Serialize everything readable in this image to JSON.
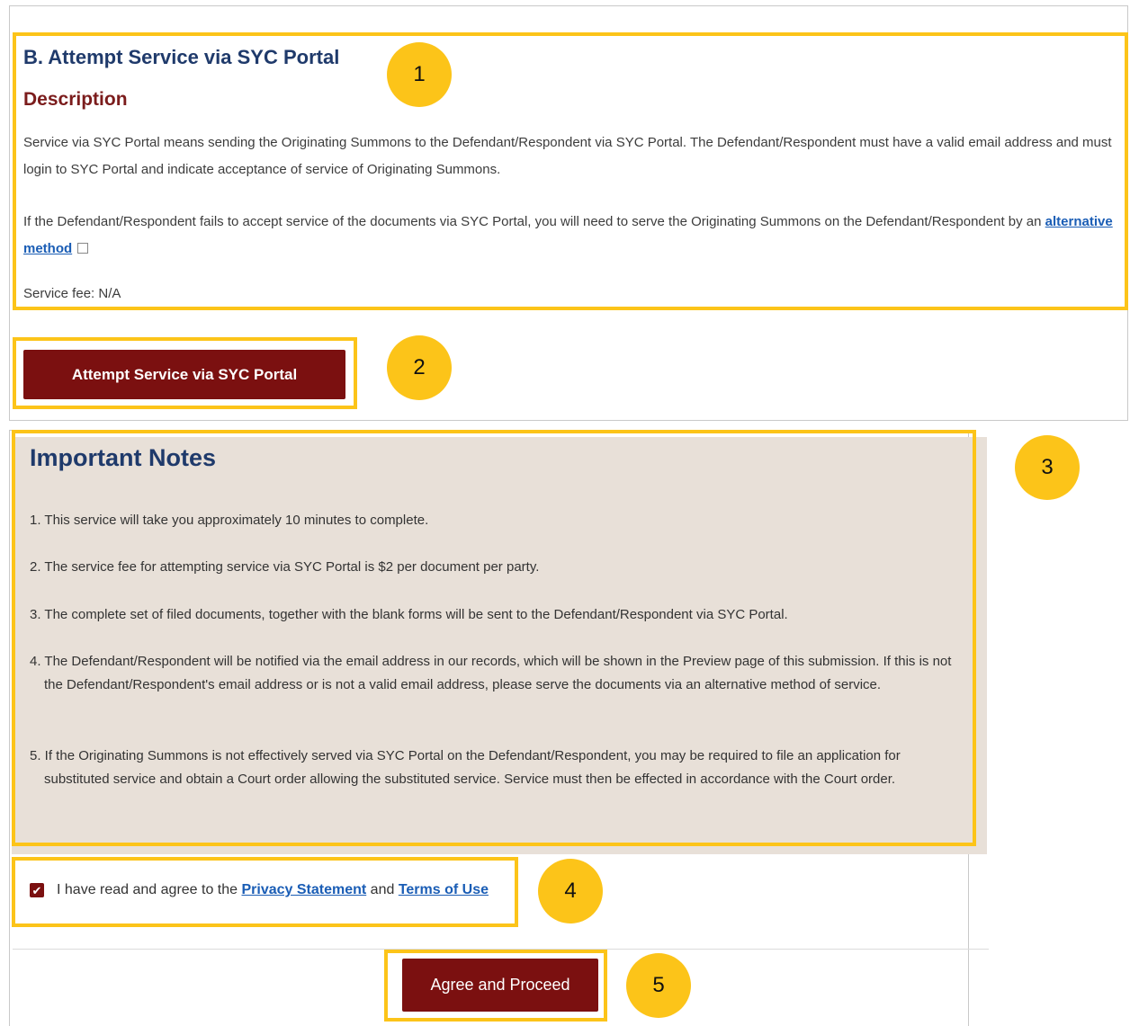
{
  "section": {
    "title": "B. Attempt Service via SYC Portal",
    "description_heading": "Description",
    "paragraph1": "Service via SYC Portal means sending the Originating Summons to the Defendant/Respondent via SYC Portal. The Defendant/Respondent must have a valid email address and must login to SYC Portal and indicate acceptance of service of Originating Summons.",
    "paragraph2_prefix": "If the Defendant/Respondent fails to accept service of the documents via SYC Portal, you will need to serve the Originating Summons on the Defendant/Respondent by an ",
    "alternative_link": "alternative method",
    "service_fee": "Service fee: N/A",
    "attempt_button": "Attempt Service via SYC Portal"
  },
  "notes": {
    "title": "Important Notes",
    "items": [
      "1. This service will take you approximately 10 minutes to complete.",
      "2. The service fee for attempting service via SYC Portal is $2 per document per party.",
      "3. The complete set of filed documents, together with the blank forms will be sent to the Defendant/Respondent via SYC Portal.",
      "4. The Defendant/Respondent will be notified via the email address in our records, which will be shown in the Preview page of this submission. If this is not the Defendant/Respondent's email address or is not a valid email address, please serve the documents via an alternative method of service.",
      "5. If the Originating Summons is not effectively served via SYC Portal on the Defendant/Respondent, you may be required to file an application for substituted service and obtain a Court order allowing the substituted service. Service must then be effected in accordance with the Court order."
    ]
  },
  "agreement": {
    "prefix": "I have read and agree to the ",
    "privacy_link": "Privacy Statement",
    "middle": " and ",
    "terms_link": "Terms of Use",
    "checked": true,
    "check_glyph": "✔"
  },
  "proceed_button": "Agree and Proceed",
  "callouts": [
    "1",
    "2",
    "3",
    "4",
    "5"
  ],
  "colors": {
    "highlight": "#fcc419",
    "brand_red": "#7b1010",
    "heading_blue": "#1f3a6b",
    "notes_bg": "#e8e0d8",
    "link": "#1a5db5"
  }
}
